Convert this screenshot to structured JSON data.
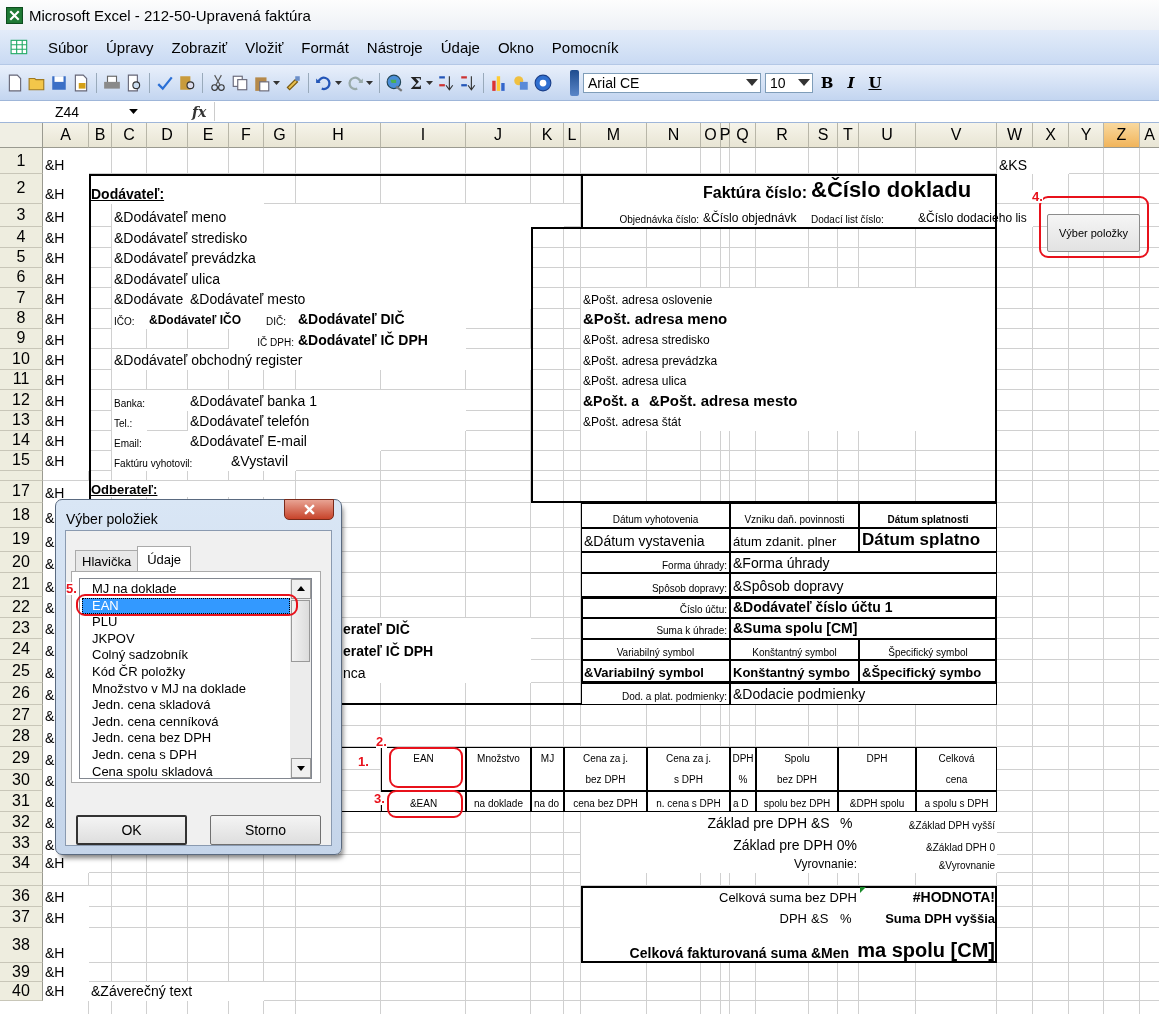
{
  "window": {
    "title": "Microsoft Excel - 212-50-Upravená faktúra"
  },
  "menu": [
    "Súbor",
    "Úpravy",
    "Zobraziť",
    "Vložiť",
    "Formát",
    "Nástroje",
    "Údaje",
    "Okno",
    "Pomocník"
  ],
  "toolbar": {
    "sigma": "Σ",
    "font": "Arial CE",
    "font_size": "10",
    "format_buttons": [
      "B",
      "I",
      "U"
    ]
  },
  "formula_bar": {
    "name_box": "Z44",
    "fx": "fx"
  },
  "columns": [
    {
      "label": "A",
      "selected": false
    },
    {
      "label": "B",
      "selected": false
    },
    {
      "label": "C",
      "selected": false
    },
    {
      "label": "D",
      "selected": false
    },
    {
      "label": "E",
      "selected": false
    },
    {
      "label": "F",
      "selected": false
    },
    {
      "label": "G",
      "selected": false
    },
    {
      "label": "H",
      "selected": false
    },
    {
      "label": "I",
      "selected": false
    },
    {
      "label": "J",
      "selected": false
    },
    {
      "label": "K",
      "selected": false
    },
    {
      "label": "L",
      "selected": false
    },
    {
      "label": "M",
      "selected": false
    },
    {
      "label": "N",
      "selected": false
    },
    {
      "label": "O",
      "selected": false
    },
    {
      "label": "P",
      "selected": false
    },
    {
      "label": "Q",
      "selected": false
    },
    {
      "label": "R",
      "selected": false
    },
    {
      "label": "S",
      "selected": false
    },
    {
      "label": "T",
      "selected": false
    },
    {
      "label": "U",
      "selected": false
    },
    {
      "label": "V",
      "selected": false
    },
    {
      "label": "W",
      "selected": false
    },
    {
      "label": "X",
      "selected": false
    },
    {
      "label": "Y",
      "selected": false
    },
    {
      "label": "Z",
      "selected": true
    },
    {
      "label": "A",
      "selected": false
    }
  ],
  "rows": [
    {
      "header": "1",
      "a": "&H"
    },
    {
      "header": "2",
      "a": "&H"
    },
    {
      "header": "3",
      "a": "&H"
    },
    {
      "header": "4",
      "a": "&H"
    },
    {
      "header": "5",
      "a": "&H"
    },
    {
      "header": "6",
      "a": "&H"
    },
    {
      "header": "7",
      "a": "&H"
    },
    {
      "header": "8",
      "a": "&H"
    },
    {
      "header": "9",
      "a": "&H"
    },
    {
      "header": "10",
      "a": "&H"
    },
    {
      "header": "11",
      "a": "&H"
    },
    {
      "header": "12",
      "a": "&H"
    },
    {
      "header": "13",
      "a": "&H"
    },
    {
      "header": "14",
      "a": "&H"
    },
    {
      "header": "15",
      "a": "&H"
    },
    {
      "header": "17",
      "a": "&H"
    },
    {
      "header": "18",
      "a": "&"
    },
    {
      "header": "19",
      "a": "&"
    },
    {
      "header": "20",
      "a": "&"
    },
    {
      "header": "21",
      "a": "&"
    },
    {
      "header": "22",
      "a": "&"
    },
    {
      "header": "23",
      "a": "&"
    },
    {
      "header": "24",
      "a": "&"
    },
    {
      "header": "25",
      "a": "&"
    },
    {
      "header": "26",
      "a": "&"
    },
    {
      "header": "27",
      "a": "&"
    },
    {
      "header": "28",
      "a": "&"
    },
    {
      "header": "29",
      "a": "&"
    },
    {
      "header": "30",
      "a": "&"
    },
    {
      "header": "31",
      "a": "&"
    },
    {
      "header": "32",
      "a": "&"
    },
    {
      "header": "33",
      "a": "&"
    },
    {
      "header": "34",
      "a": "&H"
    },
    {
      "header": "36",
      "a": "&H"
    },
    {
      "header": "37",
      "a": "&H"
    },
    {
      "header": "38",
      "a": "&H"
    },
    {
      "header": "39",
      "a": "&H"
    },
    {
      "header": "40",
      "a": "&H"
    }
  ],
  "cells": [
    "&KS",
    "Dodávateľ:",
    "Faktúra číslo:",
    "&Číslo dokladu",
    "&Dodávateľ meno",
    "Objednávka číslo:",
    "&Číslo objednávk",
    "Dodací list číslo:",
    "&Číslo dodacieho lis",
    "&Dodávateľ stredisko",
    "&Dodávateľ prevádzka",
    "&Dodávateľ ulica",
    "&Dodávate",
    "&Dodávateľ mesto",
    "IČO:",
    "&Dodávateľ IČO",
    "DIČ:",
    "&Dodávateľ DIČ",
    "IČ DPH:",
    "&Dodávateľ IČ DPH",
    "&Dodávateľ obchodný register",
    "Banka:",
    "&Dodávateľ banka 1",
    "Tel.:",
    "&Dodávateľ telefón",
    "Email:",
    "&Dodávateľ E-mail",
    "Faktúru vyhotovil:",
    "&Vystavil",
    "Odberateľ:",
    "&Pošt. adresa oslovenie",
    "&Pošt. adresa meno",
    "&Pošt. adresa stredisko",
    "&Pošt. adresa prevádzka",
    "&Pošt. adresa ulica",
    "&Pošt. a",
    "&Pošt. adresa mesto",
    "&Pošt. adresa štát",
    "Dátum vyhotovenia",
    "Vzniku daň. povinnosti",
    "Dátum splatnosti",
    "&Dátum vystavenia",
    "átum zdanit. plner",
    "Dátum splatno",
    "Forma úhrady:",
    "&Forma úhrady",
    "Spôsob dopravy:",
    "&Spôsob dopravy",
    "Číslo účtu:",
    "&Dodávateľ číslo účtu 1",
    "Suma k úhrade:",
    "&Suma spolu [CM]",
    "Variabilný symbol",
    "Konštantný symbol",
    "Špecifický symbol",
    "&Variabilný symbol",
    "Konštantný symbo",
    "&Špecifický symbo",
    "Dod. a plat. podmienky:",
    "&Dodacie podmienky",
    "erateľ DIČ",
    "erateľ IČ DPH",
    "nca",
    "EAN",
    "Množstvo",
    "MJ",
    "Cena za j.\nbez DPH",
    "Cena za j.\ns DPH",
    "DPH\n%",
    "Spolu\nbez DPH",
    "DPH",
    "Celková\ncena",
    "&EAN",
    "na doklade",
    "na do",
    "cena bez DPH",
    "n. cena s DPH",
    "a D",
    "spolu bez DPH",
    "&DPH spolu",
    "a spolu s DPH",
    "Základ pre DPH",
    "&S",
    "%",
    "&Základ DPH vyšší",
    "Základ pre DPH 0%",
    "&Základ DPH 0",
    "Vyrovnanie:",
    "&Vyrovnanie",
    "Celková suma bez DPH",
    "#HODNOTA!",
    "DPH",
    "&S",
    "%",
    "Suma DPH vyššia",
    "Celková fakturovaná suma",
    "&Men",
    "ma spolu [CM]",
    "&Záverečný text"
  ],
  "sheet_button": "Výber položky",
  "annotations": [
    "1.",
    "2.",
    "3.",
    "4.",
    "5."
  ],
  "dialog": {
    "title": "Výber položiek",
    "tabs": [
      {
        "label": "Hlavička",
        "selected": false
      },
      {
        "label": "Údaje",
        "selected": true
      }
    ],
    "items": [
      {
        "label": "MJ na doklade",
        "selected": false
      },
      {
        "label": "EAN",
        "selected": true
      },
      {
        "label": "PLU",
        "selected": false
      },
      {
        "label": "JKPOV",
        "selected": false
      },
      {
        "label": "Colný sadzobník",
        "selected": false
      },
      {
        "label": "Kód ČR položky",
        "selected": false
      },
      {
        "label": "Množstvo v MJ na doklade",
        "selected": false
      },
      {
        "label": "Jedn. cena skladová",
        "selected": false
      },
      {
        "label": "Jedn. cena cenníková",
        "selected": false
      },
      {
        "label": "Jedn. cena bez DPH",
        "selected": false
      },
      {
        "label": "Jedn. cena s DPH",
        "selected": false
      },
      {
        "label": "Cena spolu skladová",
        "selected": false
      }
    ],
    "buttons": [
      "OK",
      "Storno"
    ]
  }
}
